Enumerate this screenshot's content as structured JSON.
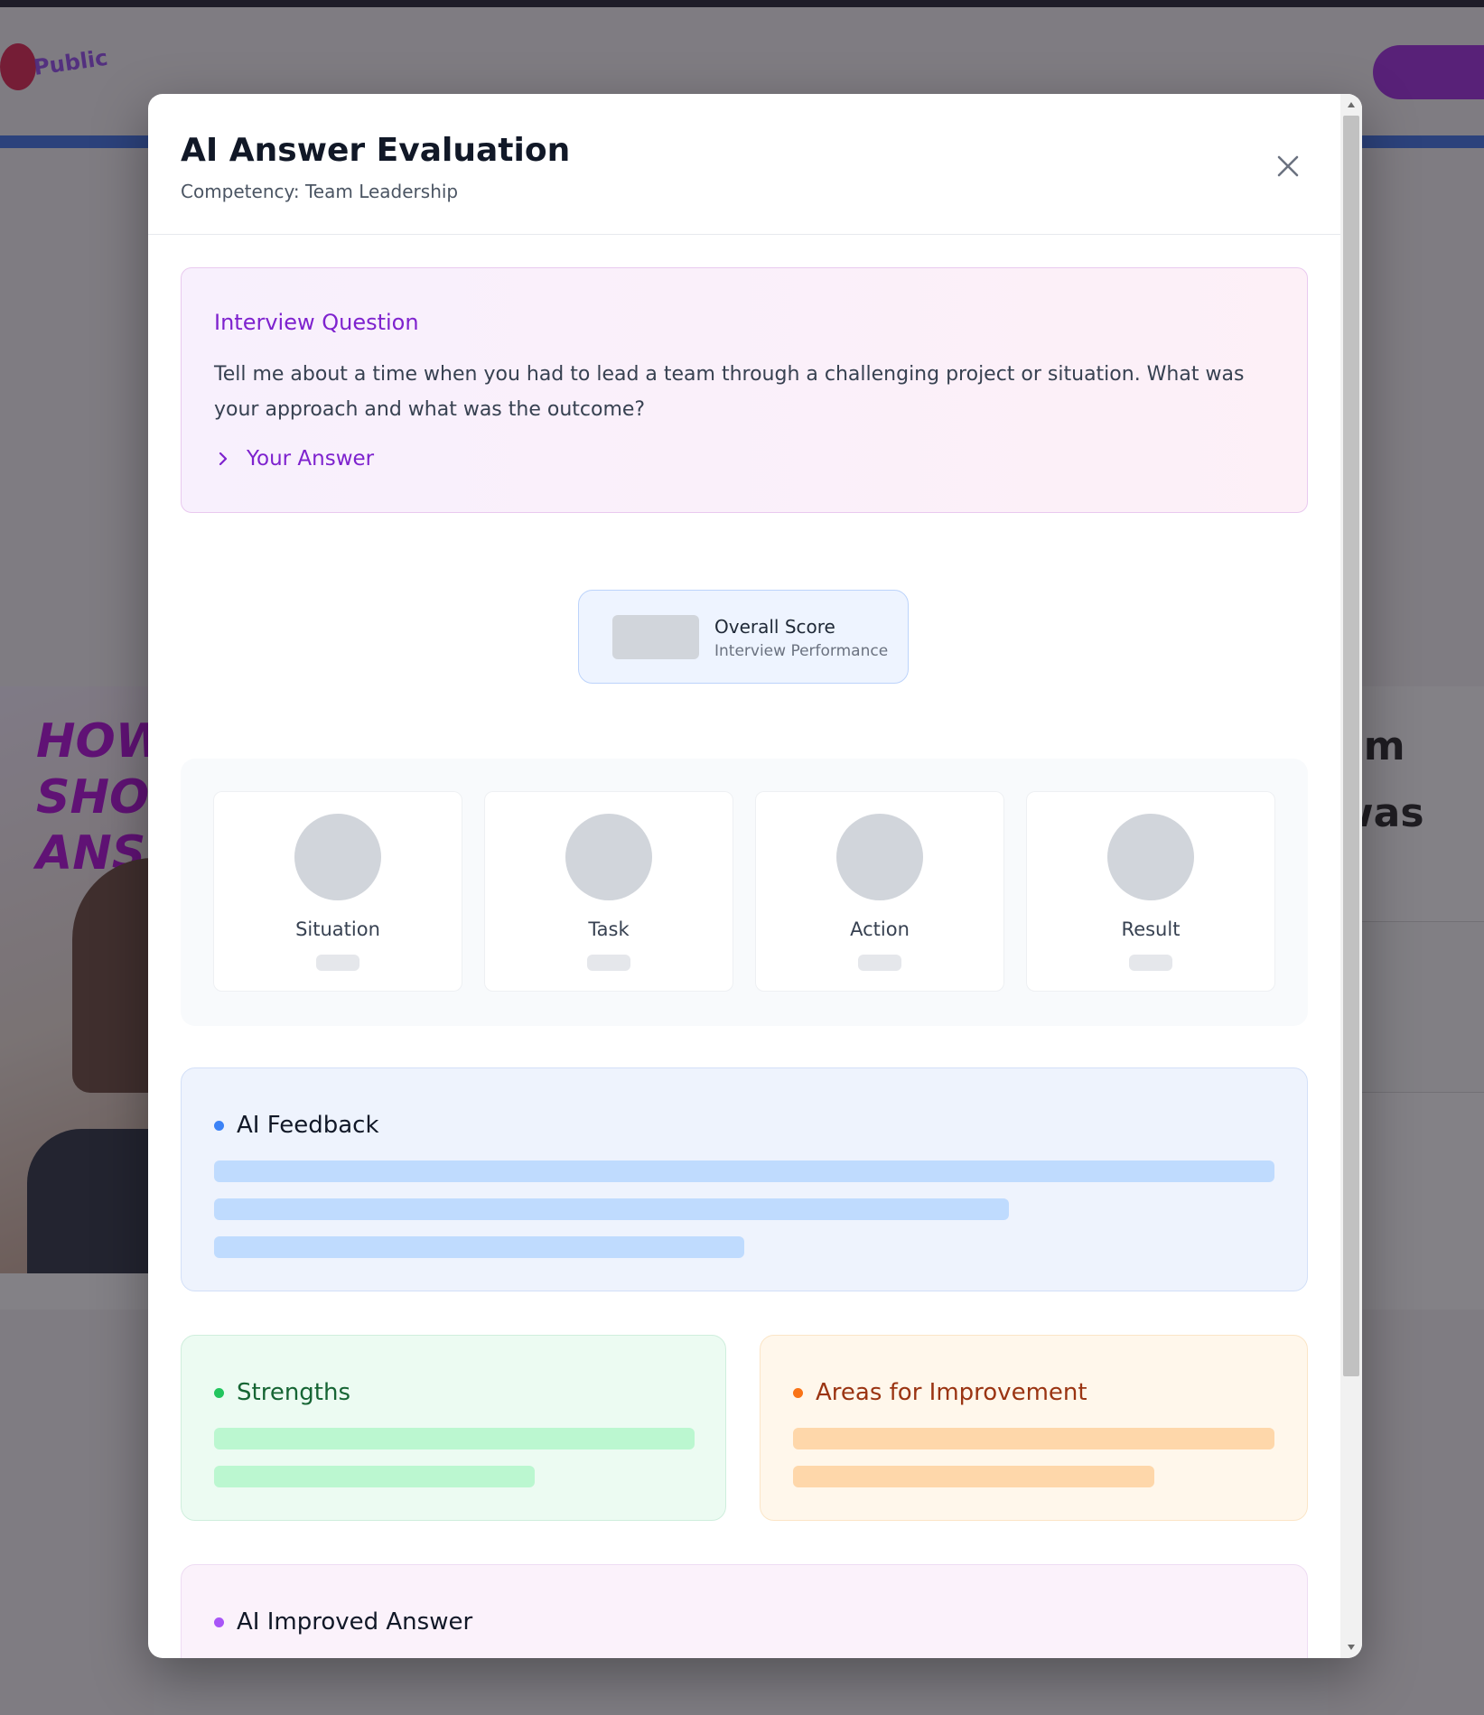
{
  "modal": {
    "title": "AI Answer Evaluation",
    "subtitle": "Competency: Team Leadership",
    "close_icon": "close-icon"
  },
  "question": {
    "heading": "Interview Question",
    "text": "Tell me about a time when you had to lead a team through a challenging project or situation. What was your approach and what was the outcome?",
    "answer_toggle_label": "Your Answer",
    "answer_toggle_icon": "chevron-right-icon"
  },
  "score": {
    "label": "Overall Score",
    "sublabel": "Interview Performance",
    "value_loading": true
  },
  "star": [
    {
      "label": "Situation"
    },
    {
      "label": "Task"
    },
    {
      "label": "Action"
    },
    {
      "label": "Result"
    }
  ],
  "feedback": {
    "title": "AI Feedback",
    "color": "#3b82f6",
    "loading_line_fractions": [
      1.0,
      0.75,
      0.5
    ]
  },
  "strengths": {
    "title": "Strengths",
    "color": "#22c55e",
    "loading_line_fractions": [
      1.0,
      0.67
    ]
  },
  "improvements": {
    "title": "Areas for Improvement",
    "color": "#f97316",
    "loading_line_fractions": [
      1.0,
      0.75
    ]
  },
  "improved_answer": {
    "title": "AI Improved Answer",
    "color": "#a855f7"
  },
  "colors": {
    "accent_purple": "#7e22ce",
    "skeleton_gray": "#d1d5db",
    "feedback_skeleton": "#bfdbfe",
    "strength_skeleton": "#bbf7d0",
    "improvement_skeleton": "#fed7aa"
  }
}
